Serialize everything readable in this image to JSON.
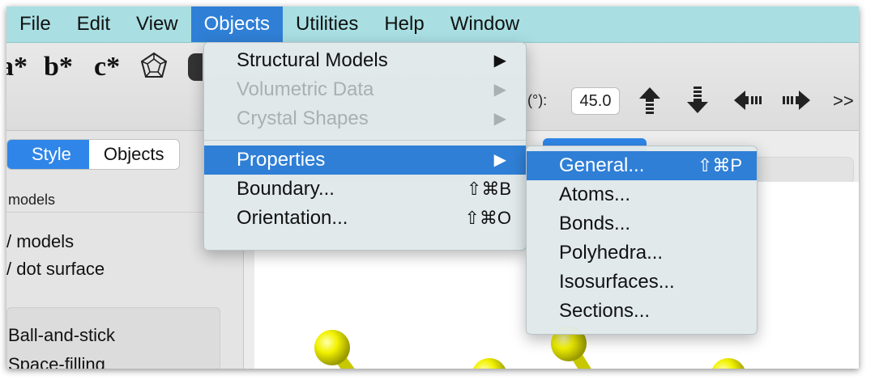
{
  "menubar": {
    "items": [
      "File",
      "Edit",
      "View",
      "Objects",
      "Utilities",
      "Help",
      "Window"
    ]
  },
  "toolbar": {
    "axis_labels": [
      "a*",
      "b*",
      "c*"
    ],
    "angle_label": "(°):",
    "angle_value": "45.0",
    "more": ">>",
    "icons": [
      "polyhedron-icon",
      "rotate-up-icon",
      "rotate-down-icon",
      "rotate-left-icon",
      "rotate-right-icon"
    ]
  },
  "left_panel": {
    "tabs": [
      "Style",
      "Objects"
    ],
    "heading": "models",
    "lines": [
      "/ models",
      "/ dot surface"
    ],
    "style_options": [
      "Ball-and-stick",
      "Space-filling"
    ]
  },
  "objects_menu": {
    "items": [
      {
        "label": "Structural Models",
        "submenu": true,
        "disabled": false
      },
      {
        "label": "Volumetric Data",
        "submenu": true,
        "disabled": true
      },
      {
        "label": "Crystal Shapes",
        "submenu": true,
        "disabled": true
      },
      {
        "label": "Properties",
        "submenu": true,
        "highlighted": true
      },
      {
        "label": "Boundary...",
        "shortcut": "⇧⌘B"
      },
      {
        "label": "Orientation...",
        "shortcut": "⇧⌘O"
      }
    ]
  },
  "properties_menu": {
    "items": [
      {
        "label": "General...",
        "shortcut": "⇧⌘P",
        "highlighted": true
      },
      {
        "label": "Atoms..."
      },
      {
        "label": "Bonds..."
      },
      {
        "label": "Polyhedra..."
      },
      {
        "label": "Isosurfaces..."
      },
      {
        "label": "Sections..."
      }
    ]
  },
  "colors": {
    "menubar": "#a9dfe2",
    "highlight": "#2f7fd6",
    "atom": "#f2f200"
  }
}
